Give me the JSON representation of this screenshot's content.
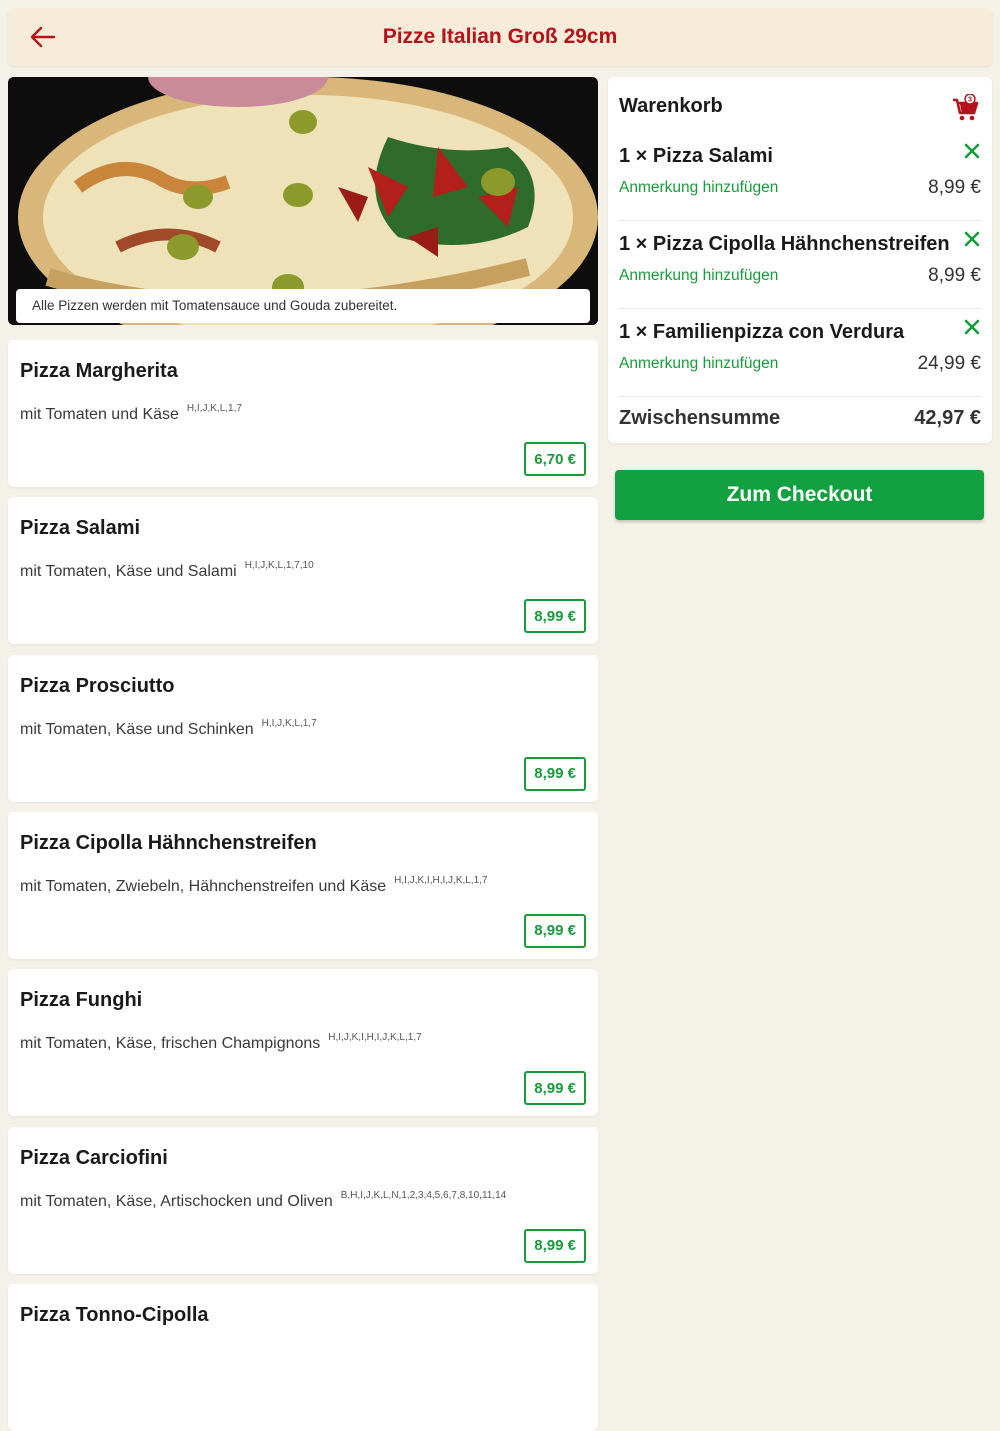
{
  "header": {
    "title": "Pizze Italian Groß 29cm"
  },
  "hero": {
    "caption": "Alle Pizzen werden mit Tomatensauce und Gouda zubereitet."
  },
  "menu": [
    {
      "name": "Pizza Margherita",
      "desc": "mit Tomaten und Käse",
      "allergens": "H,I,J,K,L,1,7",
      "price": "6,70 €"
    },
    {
      "name": "Pizza Salami",
      "desc": "mit Tomaten, Käse und Salami",
      "allergens": "H,I,J,K,L,1,7,10",
      "price": "8,99 €"
    },
    {
      "name": "Pizza Prosciutto",
      "desc": "mit Tomaten, Käse und Schinken",
      "allergens": "H,I,J,K,L,1,7",
      "price": "8,99 €"
    },
    {
      "name": "Pizza Cipolla Hähnchenstreifen",
      "desc": "mit Tomaten, Zwiebeln, Hähnchenstreifen und Käse",
      "allergens": "H,I,J,K,I,H,I,J,K,L,1,7",
      "price": "8,99 €"
    },
    {
      "name": "Pizza Funghi",
      "desc": "mit Tomaten, Käse, frischen Champignons",
      "allergens": "H,I,J,K,I,H,I,J,K,L,1,7",
      "price": "8,99 €"
    },
    {
      "name": "Pizza Carciofini",
      "desc": "mit Tomaten, Käse, Artischocken und Oliven",
      "allergens": "B,H,I,J,K,L,N,1,2,3,4,5,6,7,8,10,11,14",
      "price": "8,99 €"
    },
    {
      "name": "Pizza Tonno-Cipolla",
      "desc": "",
      "allergens": "",
      "price": ""
    }
  ],
  "cart": {
    "title": "Warenkorb",
    "count": "3",
    "items": [
      {
        "name": "1 × Pizza Salami",
        "note": "Anmerkung hinzufügen",
        "price": "8,99 €"
      },
      {
        "name": "1 × Pizza Cipolla Hähnchenstreifen",
        "note": "Anmerkung hinzufügen",
        "price": "8,99 €"
      },
      {
        "name": "1 × Familienpizza con Verdura",
        "note": "Anmerkung hinzufügen",
        "price": "24,99 €"
      }
    ],
    "subtotal_label": "Zwischensumme",
    "subtotal_value": "42,97 €"
  },
  "checkout": {
    "label": "Zum Checkout"
  },
  "colors": {
    "accent_red": "#b5121b",
    "accent_green": "#1a9a3b",
    "header_bg": "#f6ecd9"
  },
  "icons": {
    "back": "arrow-left-icon",
    "cart": "shopping-cart-icon",
    "remove": "close-icon"
  }
}
